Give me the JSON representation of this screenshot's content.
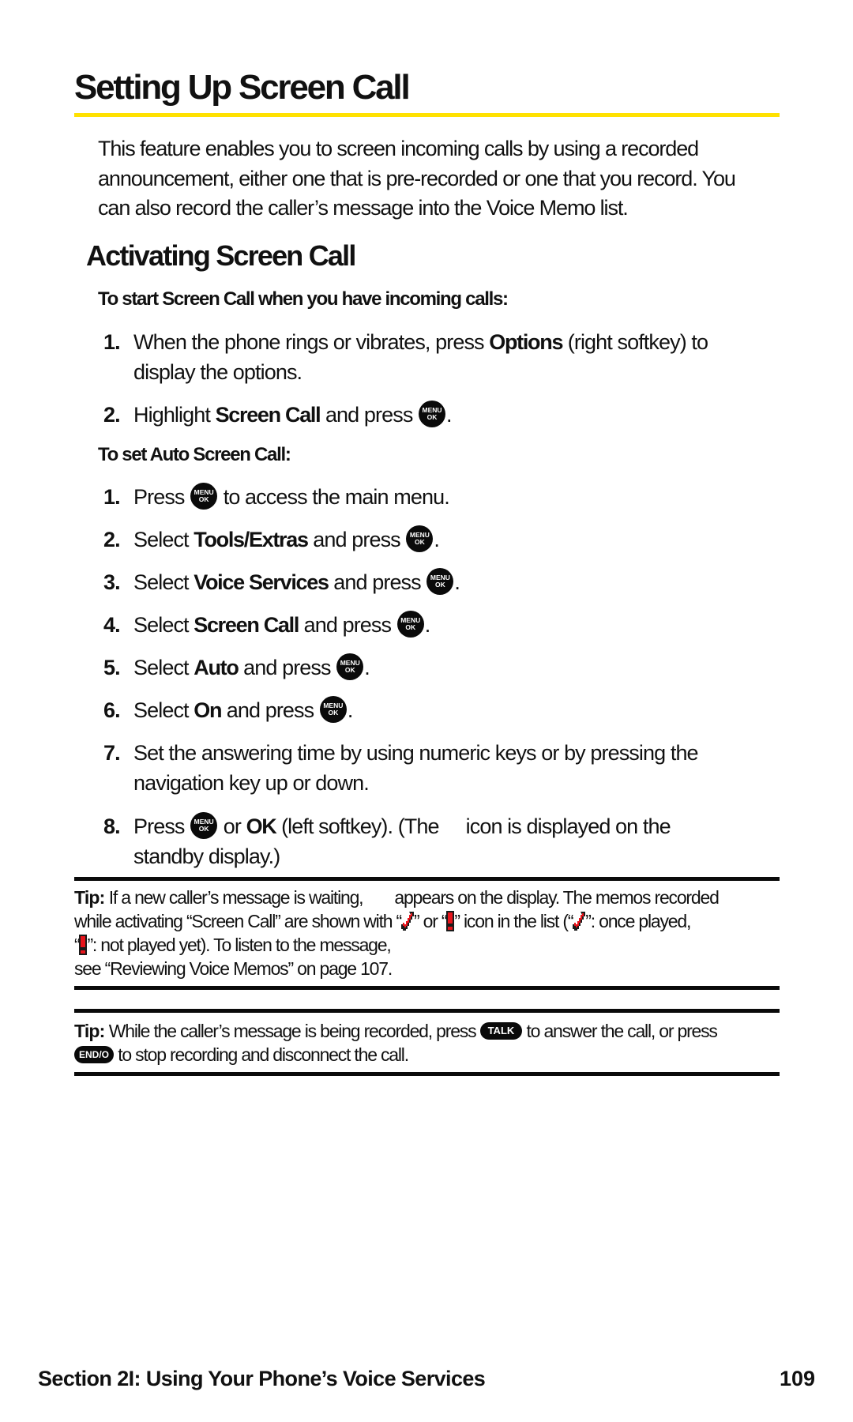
{
  "page": {
    "title": "Setting Up Screen Call",
    "accent_color": "#FFE100",
    "intro_lines": [
      "This feature enables you to screen incoming calls by using a recorded",
      "announcement, either one that is pre-recorded or one that you record. You",
      "can also record the caller’s message into the Voice Memo list."
    ],
    "section_heading": "Activating Screen Call",
    "procedure_1": {
      "lead": "To start Screen Call when you have incoming calls:",
      "steps": [
        {
          "num": "1.",
          "lines": [
            {
              "pre": "When the phone rings or vibrates, press ",
              "bold": "Options",
              "post": " (right softkey) to"
            },
            {
              "pre": "display the options."
            }
          ]
        },
        {
          "num": "2.",
          "pre": "Highlight ",
          "bold": "Screen Call",
          "post": " and press",
          "icon": "menu-ok-key-icon",
          "end": "."
        }
      ]
    },
    "procedure_2": {
      "lead": "To set Auto Screen Call:",
      "steps": [
        {
          "num": "1.",
          "pre": "Press",
          "icon": "menu-ok-key-icon",
          "post": " to access the main menu."
        },
        {
          "num": "2.",
          "pre": "Select ",
          "bold": "Tools/Extras",
          "post": " and press",
          "icon": "menu-ok-key-icon",
          "end": "."
        },
        {
          "num": "3.",
          "pre": "Select ",
          "bold": "Voice Services",
          "post": " and press",
          "icon": "menu-ok-key-icon",
          "end": "."
        },
        {
          "num": "4.",
          "pre": "Select ",
          "bold": "Screen Call",
          "post": " and press",
          "icon": "menu-ok-key-icon",
          "end": "."
        },
        {
          "num": "5.",
          "pre": "Select ",
          "bold": "Auto",
          "post": " and press",
          "icon": "menu-ok-key-icon",
          "end": "."
        },
        {
          "num": "6.",
          "pre": "Select ",
          "bold": "On",
          "post": " and press",
          "icon": "menu-ok-key-icon",
          "end": "."
        },
        {
          "num": "7.",
          "lines": [
            "Set the answering time by using numeric keys or by pressing the",
            "navigation key up or down."
          ]
        },
        {
          "num": "8.",
          "pre": "Press",
          "icon": "menu-ok-key-icon",
          "mid": " or ",
          "bold": "OK",
          "post": " (left softkey). (The",
          "post2": "icon is displayed on the",
          "line2": "standby display.)"
        }
      ]
    },
    "menu_key": {
      "top": "MENU",
      "bottom": "OK"
    },
    "tips": [
      {
        "label": "Tip:",
        "l1_a": " If a new caller’s message is waiting,",
        "l1_b": "appears on the display. The memos recorded",
        "l2_a": "while activating “Screen Call” are shown with “",
        "l2_b": "” or “",
        "l2_c": "” icon in the list (“",
        "l2_d": "”: once played,",
        "l3_a": "“",
        "l3_b": "”: not played yet). To listen to the message,",
        "l4": "see “Reviewing Voice Memos” on page 107.",
        "icon_colors": {
          "fill": "#E8141B",
          "outline": "#1a1a1a"
        }
      },
      {
        "label": "Tip:",
        "l1_a": " While the caller’s message is being recorded, press ",
        "talk_key": "TALK",
        "l1_b": " to answer the call, or press",
        "end_key": "END/O",
        "l2_b": " to stop recording and disconnect the call."
      }
    ],
    "footer": {
      "section": "Section 2I: Using Your Phone’s Voice Services",
      "page_number": "109"
    }
  }
}
